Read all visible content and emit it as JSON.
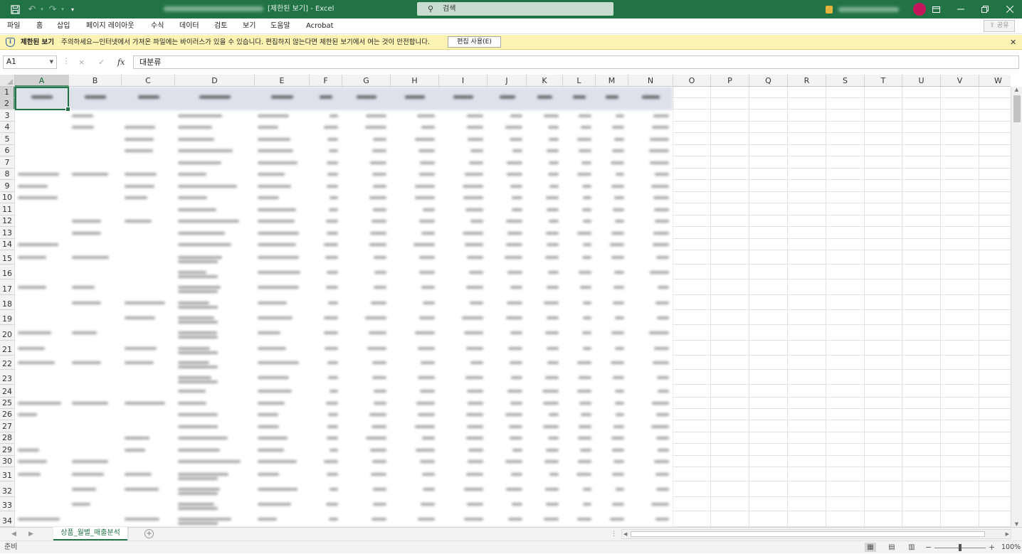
{
  "titlebar": {
    "title_suffix": "[제한된 보기] - Excel",
    "search_placeholder": "검색",
    "colors": {
      "accent": "#217346"
    }
  },
  "ribbon": {
    "tabs": [
      "파일",
      "홈",
      "삽입",
      "페이지 레이아웃",
      "수식",
      "데이터",
      "검토",
      "보기",
      "도움말",
      "Acrobat"
    ],
    "share_label": "공유"
  },
  "message_bar": {
    "title": "제한된 보기",
    "text": "주의하세요—인터넷에서 가져온 파일에는 바이러스가 있을 수 있습니다. 편집하지 않는다면 제한된 보기에서 여는 것이 안전합니다.",
    "button": "편집 사용(E)",
    "background": "#fdf3b3"
  },
  "formula_bar": {
    "name_box": "A1",
    "cancel_icon": "×",
    "enter_icon": "✓",
    "fx_label": "fx",
    "formula": "대분류"
  },
  "grid": {
    "columns": [
      "A",
      "B",
      "C",
      "D",
      "E",
      "F",
      "G",
      "H",
      "I",
      "J",
      "K",
      "L",
      "M",
      "N",
      "O",
      "P",
      "Q",
      "R",
      "S",
      "T",
      "U",
      "V",
      "W"
    ],
    "rows": [
      "1",
      "2",
      "3",
      "4",
      "5",
      "6",
      "7",
      "8",
      "9",
      "10",
      "11",
      "12",
      "13",
      "14",
      "15",
      "16",
      "17",
      "18",
      "19",
      "20",
      "21",
      "22",
      "23",
      "24",
      "25",
      "26",
      "27",
      "28",
      "29",
      "30",
      "31",
      "32",
      "33",
      "34"
    ],
    "selected_cell": "A1",
    "blurred_content": true
  },
  "sheet_tabs": {
    "tabs": [
      "상품_월별_매출분석"
    ],
    "active": "상품_월별_매출분석"
  },
  "status_bar": {
    "status": "준비",
    "zoom": "100%",
    "zoom_percent": 100
  }
}
